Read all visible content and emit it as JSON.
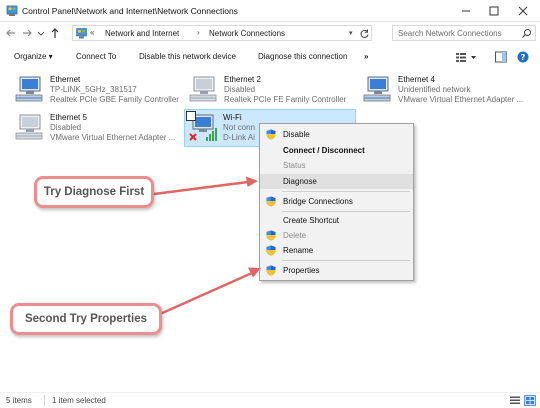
{
  "window": {
    "title": "Control Panel\\Network and Internet\\Network Connections"
  },
  "address": {
    "crumbs": [
      "Network and Internet",
      "Network Connections"
    ],
    "chevron": "«",
    "separator": "›",
    "dropdown": "▾"
  },
  "search": {
    "placeholder": "Search Network Connections"
  },
  "toolbar": {
    "organize": "Organize ▾",
    "connect_to": "Connect To",
    "disable_device": "Disable this network device",
    "diagnose": "Diagnose this connection",
    "more": "»"
  },
  "connections": [
    {
      "name": "Ethernet",
      "status": "TP-LINK_5GHz_381517",
      "device": "Realtek PCIe GBE Family Controller",
      "icon": "ethernet-adapter-icon"
    },
    {
      "name": "Ethernet 2",
      "status": "Disabled",
      "device": "Realtek PCIe FE Family Controller",
      "icon": "ethernet-adapter-icon"
    },
    {
      "name": "Ethernet 4",
      "status": "Unidentified network",
      "device": "VMware Virtual Ethernet Adapter ...",
      "icon": "ethernet-adapter-icon"
    },
    {
      "name": "Ethernet 5",
      "status": "Disabled",
      "device": "VMware Virtual Ethernet Adapter ...",
      "icon": "ethernet-adapter-icon"
    },
    {
      "name": "Wi-Fi",
      "status": "Not conn",
      "device": "D-Link Ai",
      "icon": "wifi-adapter-icon"
    }
  ],
  "context_menu": {
    "items": [
      {
        "label": "Disable",
        "shield": true
      },
      {
        "label": "Connect / Disconnect",
        "bold": true
      },
      {
        "label": "Status",
        "disabled": true
      },
      {
        "label": "Diagnose",
        "highlighted": true
      },
      {
        "label": "Bridge Connections",
        "shield": true
      },
      {
        "label": "Create Shortcut"
      },
      {
        "label": "Delete",
        "shield": true,
        "disabled": true
      },
      {
        "label": "Rename",
        "shield": true
      },
      {
        "label": "Properties",
        "shield": true
      }
    ]
  },
  "callouts": {
    "first": "Try Diagnose First",
    "second": "Second Try Properties"
  },
  "statusbar": {
    "items": "5 items",
    "selected": "1 item selected"
  },
  "colors": {
    "accent": "#0078d7",
    "selection_bg": "#cce8ff",
    "callout_border": "#ec8e8e",
    "arrow": "#e06666"
  }
}
